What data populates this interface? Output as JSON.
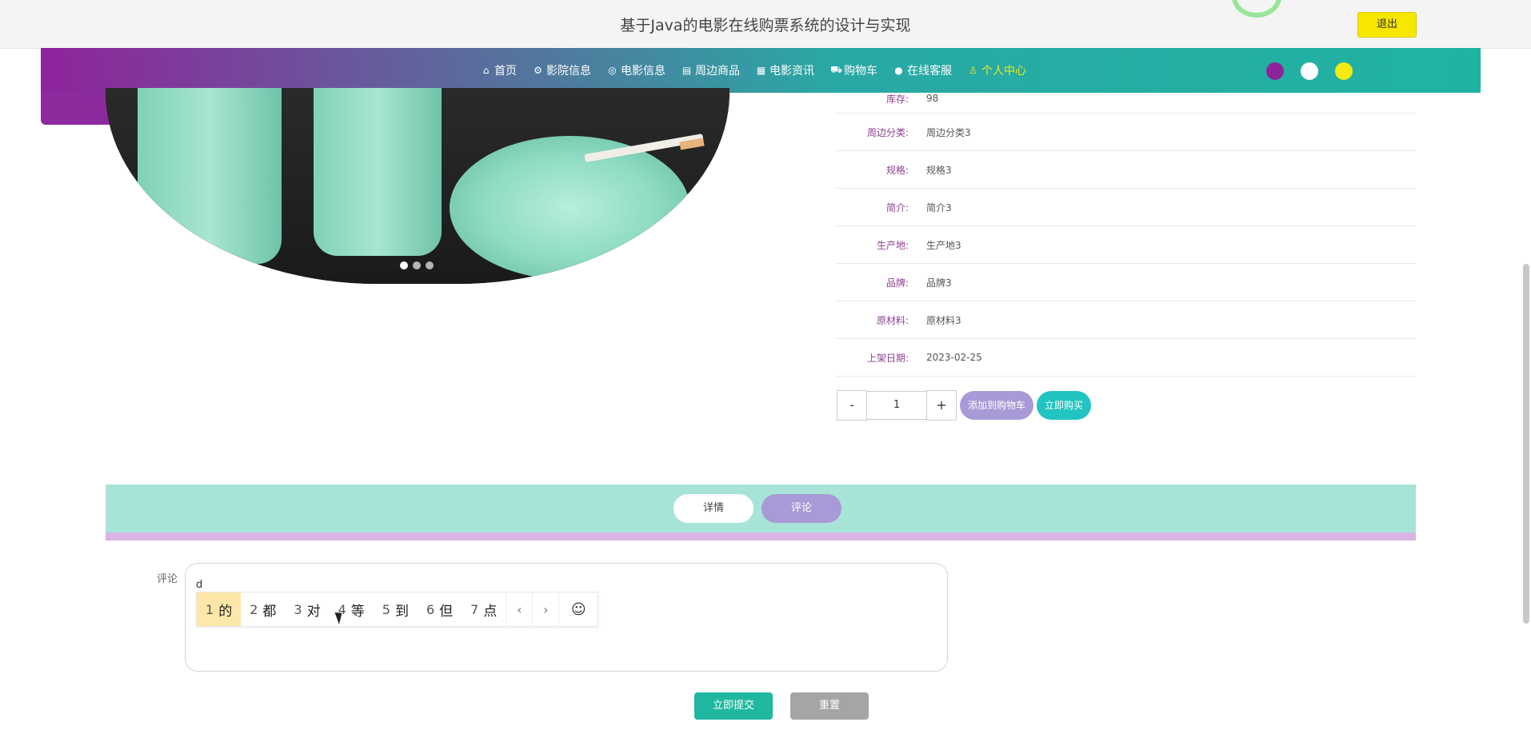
{
  "header": {
    "site_title": "基于Java的电影在线购票系统的设计与实现",
    "logout_label": "退出"
  },
  "nav": {
    "items": [
      {
        "icon": "home-icon",
        "glyph": "⌂",
        "label": "首页"
      },
      {
        "icon": "cinema-icon",
        "glyph": "⚙",
        "label": "影院信息"
      },
      {
        "icon": "film-icon",
        "glyph": "◎",
        "label": "电影信息"
      },
      {
        "icon": "goods-icon",
        "glyph": "▤",
        "label": "周边商品"
      },
      {
        "icon": "news-icon",
        "glyph": "▦",
        "label": "电影资讯"
      },
      {
        "icon": "cart-icon",
        "glyph": "⛟",
        "label": "购物车"
      },
      {
        "icon": "service-icon",
        "glyph": "●",
        "label": "在线客服"
      },
      {
        "icon": "user-icon",
        "glyph": "♙",
        "label": "个人中心"
      }
    ],
    "theme_colors": [
      "#8f239c",
      "#ffffff",
      "#f5e914"
    ]
  },
  "product": {
    "carousel_dots": 3,
    "carousel_active": 0,
    "specs": [
      {
        "label": "库存:",
        "value": "98"
      },
      {
        "label": "周边分类:",
        "value": "周边分类3"
      },
      {
        "label": "规格:",
        "value": "规格3"
      },
      {
        "label": "简介:",
        "value": "简介3"
      },
      {
        "label": "生产地:",
        "value": "生产地3"
      },
      {
        "label": "品牌:",
        "value": "品牌3"
      },
      {
        "label": "原材料:",
        "value": "原材料3"
      },
      {
        "label": "上架日期:",
        "value": "2023-02-25"
      }
    ],
    "qty_minus": "-",
    "qty_value": "1",
    "qty_plus": "+",
    "add_to_cart": "添加到购物车",
    "buy_now": "立即购买"
  },
  "tabs": {
    "detail": "详情",
    "comment": "评论"
  },
  "comment_form": {
    "label": "评论",
    "typed": "d",
    "ime_candidates": [
      {
        "num": "1",
        "char": "的"
      },
      {
        "num": "2",
        "char": "都"
      },
      {
        "num": "3",
        "char": "对"
      },
      {
        "num": "4",
        "char": "等"
      },
      {
        "num": "5",
        "char": "到"
      },
      {
        "num": "6",
        "char": "但"
      },
      {
        "num": "7",
        "char": "点"
      }
    ],
    "ime_prev": "‹",
    "ime_next": "›",
    "ime_emoji": "☺",
    "submit": "立即提交",
    "reset": "重置"
  }
}
